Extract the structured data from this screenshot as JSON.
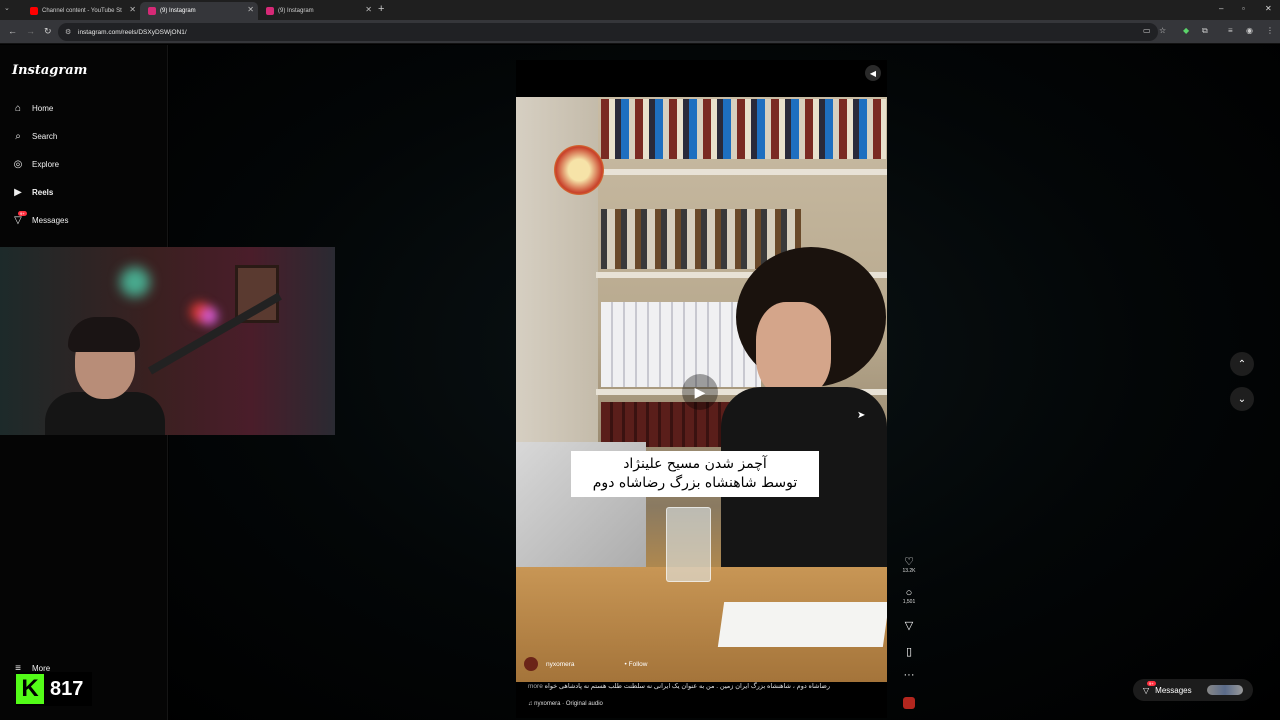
{
  "browser": {
    "tabs": [
      {
        "title": "Channel content - YouTube St",
        "favicon_color": "#ff0000",
        "active": false
      },
      {
        "title": "(9) Instagram",
        "favicon_color": "#d62976",
        "active": true
      },
      {
        "title": "(9) Instagram",
        "favicon_color": "#d62976",
        "active": false
      }
    ],
    "url": "instagram.com/reels/DSXyDSWjON1/"
  },
  "sidebar": {
    "logo": "Instagram",
    "items": [
      {
        "label": "Home",
        "icon": "home-icon"
      },
      {
        "label": "Search",
        "icon": "search-icon"
      },
      {
        "label": "Explore",
        "icon": "compass-icon"
      },
      {
        "label": "Reels",
        "icon": "reels-icon"
      },
      {
        "label": "Messages",
        "icon": "messenger-icon",
        "badge": "9+"
      }
    ],
    "more_label": "More"
  },
  "reel": {
    "overlay_line1": "آچمز شدن مسیح علینژاد",
    "overlay_line2": "توسط شاهنشاه بزرگ رضاشاه دوم",
    "owner": "nyxomera",
    "follow_label": "Follow",
    "description": "رضاشاه دوم ، شاهنشاه بزرگ ایران زمین . من به عنوان یک ایرانی نه سلطنت طلب هستم نه پادشاهی خواه",
    "more_label": "more",
    "audio_label": "nyxomera · Original audio"
  },
  "actions": {
    "likes": "13.2K",
    "comments": "1,501"
  },
  "messages_pill": {
    "label": "Messages",
    "badge": "9+"
  },
  "stream_overlay": {
    "kick_letter": "K",
    "viewer_count": "817"
  }
}
